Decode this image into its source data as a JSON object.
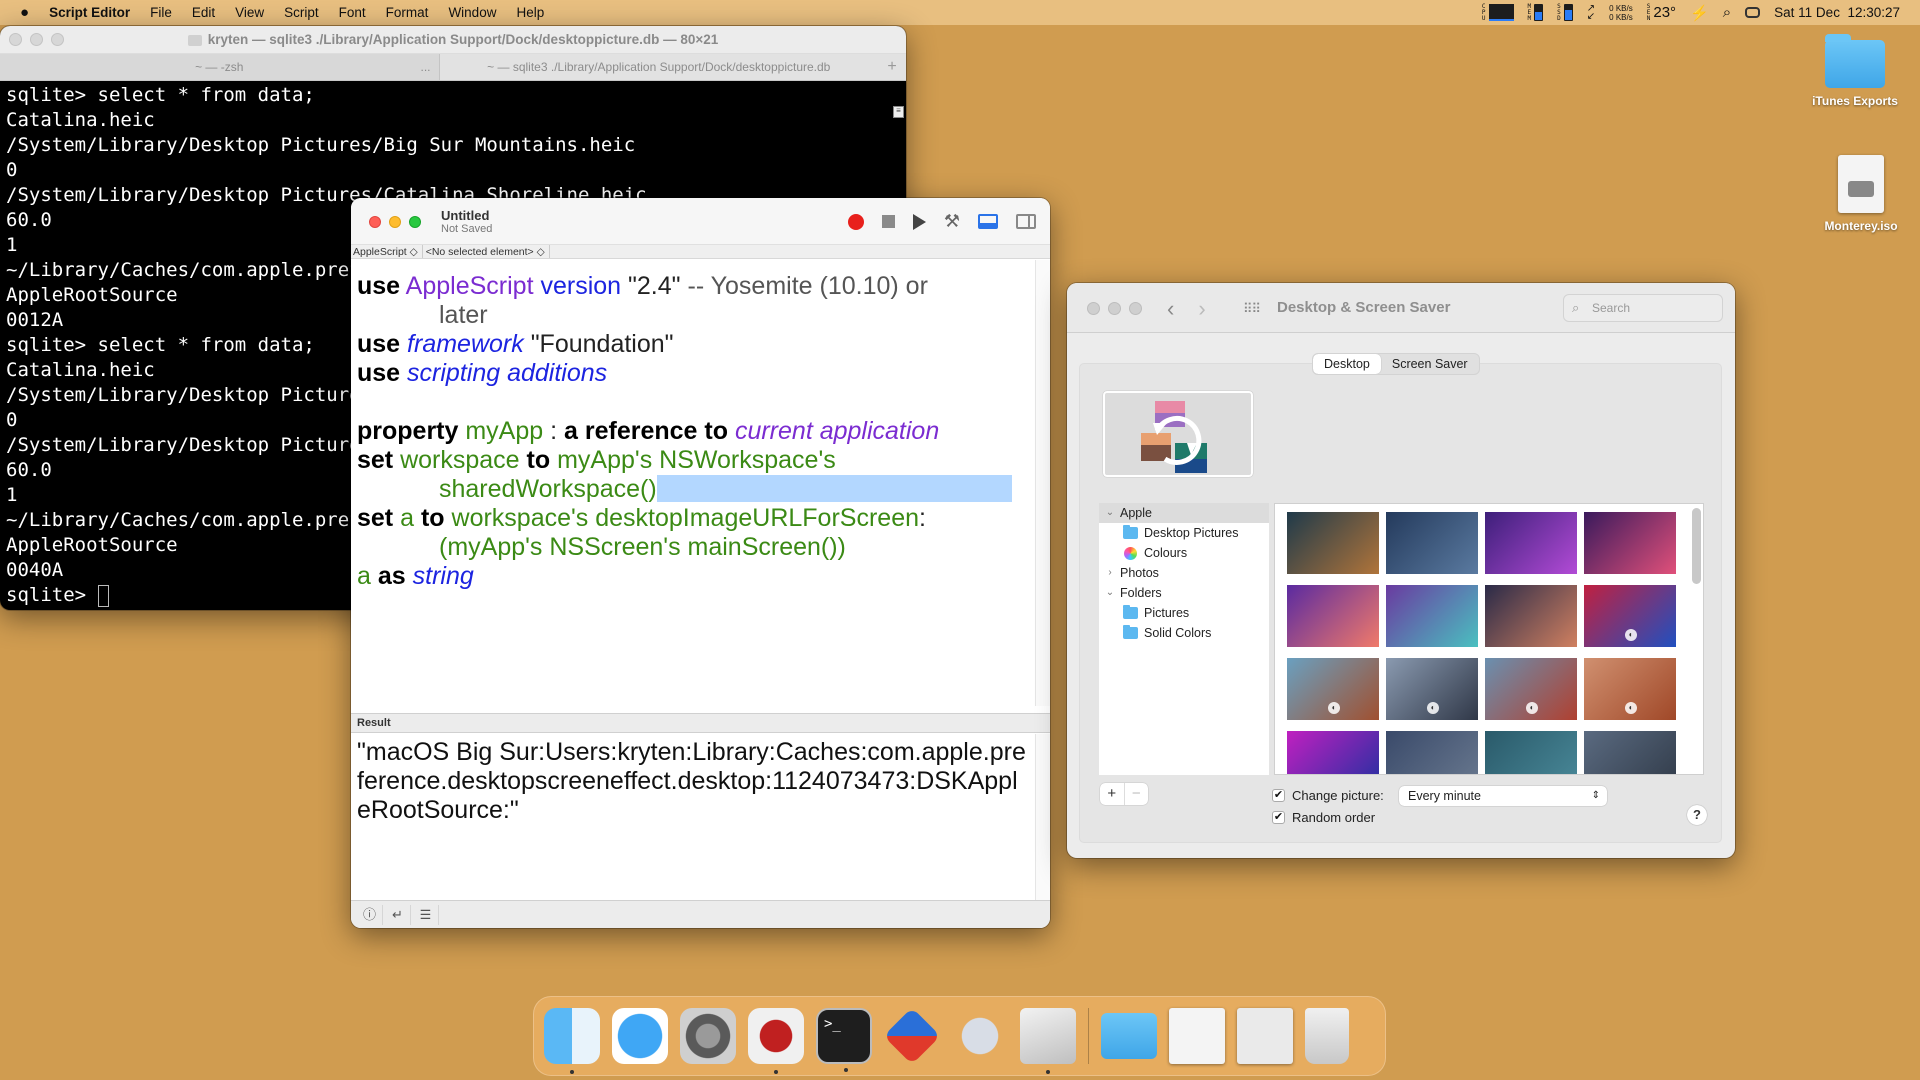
{
  "menubar": {
    "apple_icon": "apple-logo",
    "app_name": "Script Editor",
    "items": [
      "File",
      "Edit",
      "View",
      "Script",
      "Font",
      "Format",
      "Window",
      "Help"
    ],
    "status": {
      "cpu_label": "CPU",
      "mem_label": "MEM",
      "mem_fill": 0.55,
      "ssd_label": "SSD",
      "ssd_fill": 0.7,
      "net_up": "0 KB/s",
      "net_down": "0 KB/s",
      "sensor_label": "SEN",
      "temperature": "23°",
      "datetime": "Sat 11 Dec  12:30:27"
    }
  },
  "terminal": {
    "title": "kryten — sqlite3 ./Library/Application Support/Dock/desktoppicture.db — 80×21",
    "tabs": [
      {
        "label": "~ — -zsh",
        "active": false
      },
      {
        "label": "~ — sqlite3 ./Library/Application Support/Dock/desktoppicture.db",
        "active": true
      }
    ],
    "tab_overflow": "...",
    "new_tab": "+",
    "lines": [
      "sqlite> select * from data;",
      "Catalina.heic",
      "/System/Library/Desktop Pictures/Big Sur Mountains.heic",
      "0",
      "/System/Library/Desktop Pictures/Catalina Shoreline.heic",
      "60.0",
      "1",
      "~/Library/Caches/com.apple.prefe",
      "AppleRootSource",
      "0012A",
      "sqlite> select * from data;",
      "Catalina.heic",
      "/System/Library/Desktop Pictures",
      "0",
      "/System/Library/Desktop Pictures",
      "60.0",
      "1",
      "~/Library/Caches/com.apple.prefe",
      "AppleRootSource",
      "0040A",
      "sqlite> "
    ]
  },
  "script_editor": {
    "title": "Untitled",
    "subtitle": "Not Saved",
    "language_popup": "AppleScript ◇",
    "element_popup": "<No selected element> ◇",
    "code": {
      "l1": {
        "a": "use",
        "b": "AppleScript",
        "c": "version",
        "d": "\"2.4\"",
        "e": "-- Yosemite (10.10) or"
      },
      "l1b": "later",
      "l2": {
        "a": "use",
        "b": "framework",
        "c": "\"Foundation\""
      },
      "l3": {
        "a": "use",
        "b": "scripting additions"
      },
      "l4": {
        "a": "property",
        "b": "myApp",
        "c": ":",
        "d": "a reference to",
        "e": "current application"
      },
      "l5": {
        "a": "set",
        "b": "workspace",
        "c": "to",
        "d": "myApp's NSWorkspace's"
      },
      "l5b": "sharedWorkspace()",
      "l6": {
        "a": "set",
        "b": "a",
        "c": "to",
        "d": "workspace's desktopImageURLForScreen",
        "e": ":"
      },
      "l6b": "(myApp's NSScreen's mainScreen())",
      "l7": {
        "a": "a",
        "b": "as",
        "c": "string"
      }
    },
    "result_label": "Result",
    "result_text": "\"macOS Big Sur:Users:kryten:Library:Caches:com.apple.preference.desktopscreeneffect.desktop:1124073473:DSKAppleRootSource:\""
  },
  "prefs": {
    "title": "Desktop & Screen Saver",
    "search_placeholder": "Search",
    "tabs": [
      {
        "label": "Desktop",
        "active": true
      },
      {
        "label": "Screen Saver",
        "active": false
      }
    ],
    "sidebar": [
      {
        "label": "Apple",
        "level": 0,
        "disclosure": "⌄",
        "selected": true
      },
      {
        "label": "Desktop Pictures",
        "level": 1,
        "icon": "folder-icon"
      },
      {
        "label": "Colours",
        "level": 1,
        "icon": "color-wheel-icon"
      },
      {
        "label": "Photos",
        "level": 0,
        "disclosure": "›"
      },
      {
        "label": "Folders",
        "level": 0,
        "disclosure": "⌄"
      },
      {
        "label": "Pictures",
        "level": 1,
        "icon": "folder-icon"
      },
      {
        "label": "Solid Colors",
        "level": 1,
        "icon": "folder-icon"
      }
    ],
    "thumbnails": [
      {
        "c1": "#1f3a4a",
        "c2": "#b0743a",
        "dynamic": false
      },
      {
        "c1": "#243a5c",
        "c2": "#5a7aa0",
        "dynamic": false
      },
      {
        "c1": "#3d1f7a",
        "c2": "#b24bd6",
        "dynamic": false
      },
      {
        "c1": "#3a1a5c",
        "c2": "#e0507a",
        "dynamic": false
      },
      {
        "c1": "#5a2aa0",
        "c2": "#f07a6a",
        "dynamic": false
      },
      {
        "c1": "#6a3aa0",
        "c2": "#4ac0c0",
        "dynamic": false
      },
      {
        "c1": "#2a2a48",
        "c2": "#d08060",
        "dynamic": false
      },
      {
        "c1": "#c02040",
        "c2": "#2050c0",
        "dynamic": true
      },
      {
        "c1": "#6aa0c0",
        "c2": "#a05030",
        "dynamic": true
      },
      {
        "c1": "#8a9ab0",
        "c2": "#303848",
        "dynamic": true
      },
      {
        "c1": "#6a90b0",
        "c2": "#b04030",
        "dynamic": true
      },
      {
        "c1": "#d09070",
        "c2": "#a04828",
        "dynamic": true
      },
      {
        "c1": "#c020c0",
        "c2": "#2030a0",
        "dynamic": false
      },
      {
        "c1": "#3a4a6a",
        "c2": "#6a7a90",
        "dynamic": false
      },
      {
        "c1": "#2a5a6a",
        "c2": "#4a8a9a",
        "dynamic": false
      },
      {
        "c1": "#5a6a80",
        "c2": "#303a48",
        "dynamic": false
      }
    ],
    "add_label": "+",
    "remove_label": "−",
    "change_picture_label": "Change picture:",
    "change_picture_checked": true,
    "change_picture_interval": "Every minute",
    "random_order_label": "Random order",
    "random_order_checked": true,
    "help_label": "?"
  },
  "desktop_icons": [
    {
      "label": "iTunes Exports",
      "icon": "folder-icon"
    },
    {
      "label": "Monterey.iso",
      "icon": "disk-image-icon"
    }
  ],
  "dock": {
    "apps": [
      "Finder",
      "Safari",
      "System Preferences",
      "Debugger",
      "Terminal",
      "Parallels",
      "Automator",
      "Script Editor"
    ],
    "running": [
      true,
      false,
      false,
      true,
      true,
      false,
      false,
      true
    ],
    "stacks": [
      "Downloads",
      "Documents",
      "Recent",
      "Trash"
    ]
  }
}
